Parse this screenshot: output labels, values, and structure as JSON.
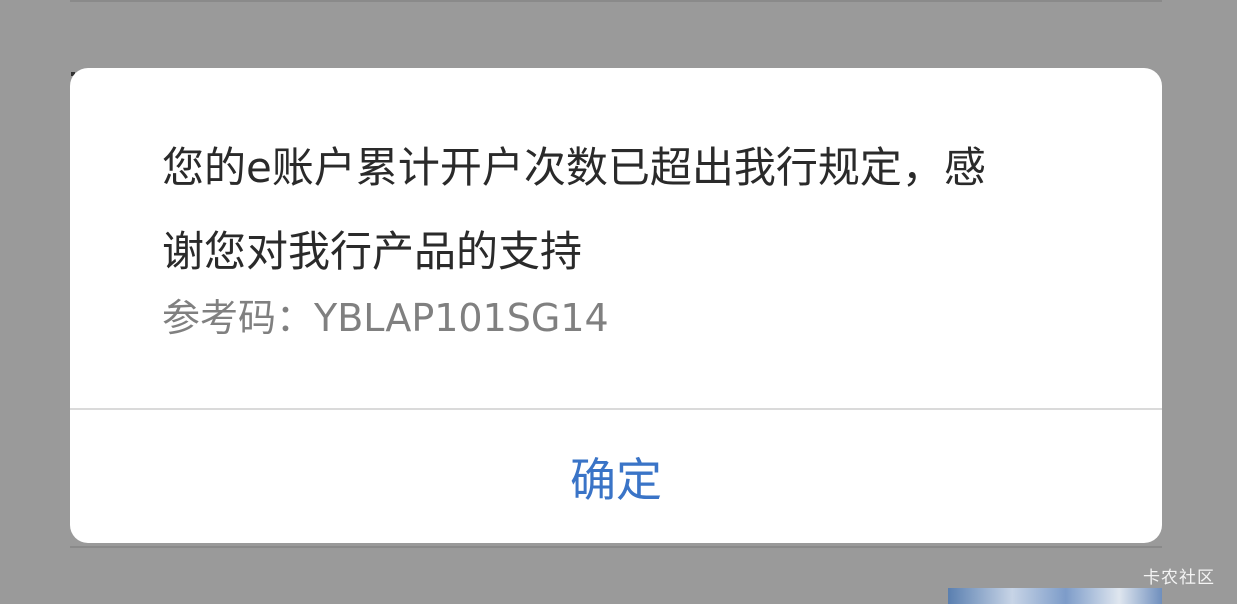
{
  "dialog": {
    "message": "您的e账户累计开户次数已超出我行规定，感谢您对我行产品的支持",
    "reference_label": "参考码：",
    "reference_code": "YBLAP101SG14",
    "confirm_label": "确定"
  },
  "watermark": "卡农社区",
  "colors": {
    "overlay": "#9a9a9a",
    "dialog_background": "#ffffff",
    "message_text": "#2a2a2a",
    "reference_text": "#808080",
    "confirm_text": "#3a74c7"
  }
}
